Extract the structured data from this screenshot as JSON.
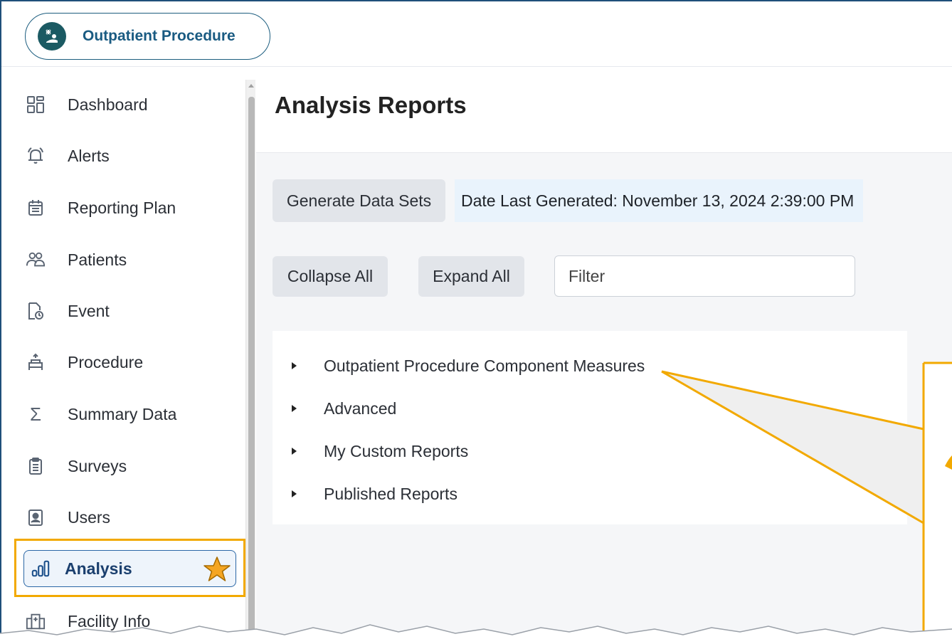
{
  "app": {
    "title": "Outpatient Procedure"
  },
  "sidebar": {
    "items": [
      {
        "label": "Dashboard",
        "icon": "dashboard-grid-icon"
      },
      {
        "label": "Alerts",
        "icon": "bell-icon"
      },
      {
        "label": "Reporting Plan",
        "icon": "calendar-icon"
      },
      {
        "label": "Patients",
        "icon": "people-icon"
      },
      {
        "label": "Event",
        "icon": "document-clock-icon"
      },
      {
        "label": "Procedure",
        "icon": "procedure-bed-icon"
      },
      {
        "label": "Summary Data",
        "icon": "sigma-icon"
      },
      {
        "label": "Surveys",
        "icon": "clipboard-list-icon"
      },
      {
        "label": "Users",
        "icon": "user-badge-icon"
      },
      {
        "label": "Analysis",
        "icon": "bar-chart-icon",
        "active": true
      },
      {
        "label": "Facility Info",
        "icon": "building-icon"
      }
    ]
  },
  "main": {
    "title": "Analysis Reports",
    "generate_label": "Generate Data Sets",
    "date_label": "Date Last Generated: November 13, 2024 2:39:00 PM",
    "collapse_label": "Collapse All",
    "expand_label": "Expand All",
    "filter_placeholder": "Filter",
    "tree": [
      "Outpatient Procedure Component Measures",
      "Advanced",
      "My Custom Reports",
      "Published Reports"
    ]
  },
  "colors": {
    "accent": "#f2a900",
    "brand": "#1a5b82",
    "active_bg": "#eef4fb"
  }
}
